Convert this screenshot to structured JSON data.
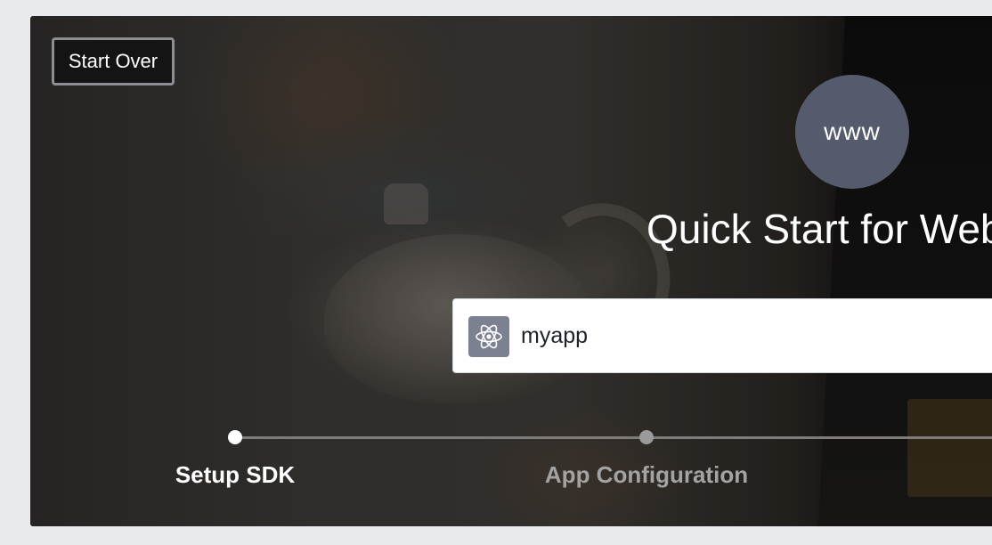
{
  "header": {
    "start_over_label": "Start Over"
  },
  "platform": {
    "icon_label": "www",
    "title": "Quick Start for Web"
  },
  "app": {
    "name": "myapp",
    "icon": "atom-icon"
  },
  "steps": [
    {
      "label": "Setup SDK",
      "state": "active"
    },
    {
      "label": "App Configuration",
      "state": "inactive"
    }
  ],
  "colors": {
    "platform_circle": "#555b6c",
    "app_icon_bg": "#7c8192",
    "step_inactive": "#a3a3a3"
  }
}
